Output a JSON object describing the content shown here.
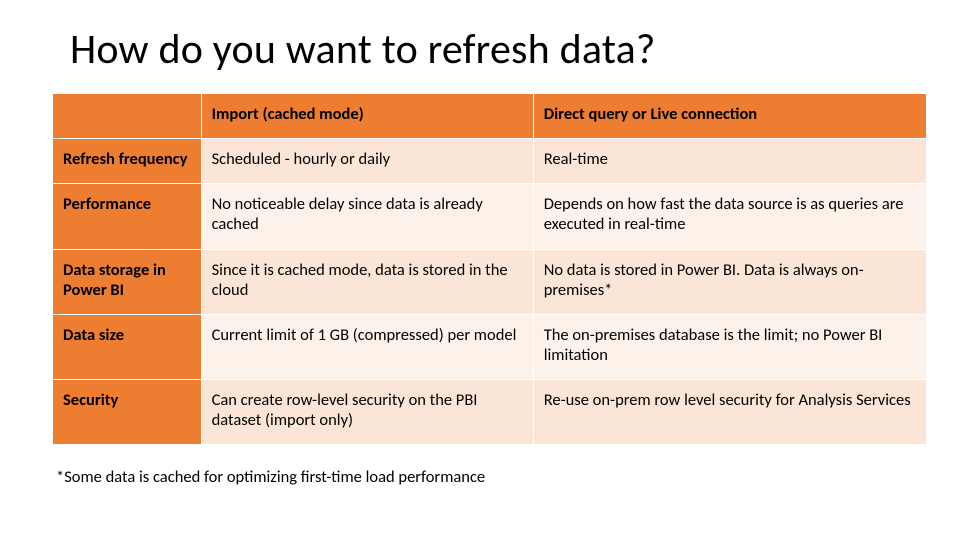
{
  "title": "How do you want to refresh data?",
  "table": {
    "headers": [
      "",
      "Import (cached mode)",
      "Direct query or Live connection"
    ],
    "rows": [
      {
        "label": "Refresh frequency",
        "import": "Scheduled - hourly or daily",
        "direct": "Real-time"
      },
      {
        "label": "Performance",
        "import": "No noticeable delay since data is already cached",
        "direct": "Depends on how fast the data source is as queries are executed in real-time"
      },
      {
        "label": "Data storage in Power BI",
        "import": "Since it is cached mode, data is stored in the cloud",
        "direct": "No data is stored in Power BI. Data is always on-premises*"
      },
      {
        "label": "Data size",
        "import": "Current limit of 1 GB (compressed) per model",
        "direct": "The on-premises database is the limit; no Power BI limitation"
      },
      {
        "label": "Security",
        "import": "Can create row-level security on the PBI dataset (import only)",
        "direct": "Re-use on-prem row level security for Analysis Services"
      }
    ]
  },
  "footnote": "*Some data is cached for optimizing first-time load performance"
}
